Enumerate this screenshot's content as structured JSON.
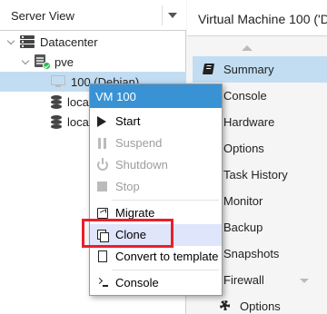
{
  "left_pane": {
    "view_selector": {
      "value": "Server View"
    },
    "tree": {
      "datacenter": {
        "label": "Datacenter",
        "icon": "datacenter-icon"
      },
      "node": {
        "label": "pve",
        "icon": "server-node-icon",
        "status_color": "#21bf4b"
      },
      "vm": {
        "label": "100 (Debian)",
        "icon": "vm-icon"
      },
      "storages": [
        {
          "label": "loca",
          "icon": "storage-icon"
        },
        {
          "label": "loca",
          "icon": "storage-icon"
        }
      ]
    }
  },
  "right_pane": {
    "header_title": "Virtual Machine 100 ('De",
    "nav": [
      {
        "label": "Summary",
        "active": true
      },
      {
        "label": "Console"
      },
      {
        "label": "Hardware"
      },
      {
        "label": "Options"
      },
      {
        "label": "Task History"
      },
      {
        "label": "Monitor"
      },
      {
        "label": "Backup"
      },
      {
        "label": "Snapshots"
      },
      {
        "label": "Firewall"
      },
      {
        "label": "Options",
        "sub": true
      }
    ]
  },
  "context_menu": {
    "title": "VM 100",
    "items": [
      {
        "label": "Start",
        "icon": "play-icon",
        "enabled": true
      },
      {
        "label": "Suspend",
        "icon": "pause-icon",
        "enabled": false
      },
      {
        "label": "Shutdown",
        "icon": "power-icon",
        "enabled": false
      },
      {
        "label": "Stop",
        "icon": "stop-icon",
        "enabled": false
      },
      {
        "label": "Migrate",
        "icon": "send-icon",
        "enabled": true
      },
      {
        "label": "Clone",
        "icon": "clone-icon",
        "enabled": true,
        "highlighted": true
      },
      {
        "label": "Convert to template",
        "icon": "file-icon",
        "enabled": true
      },
      {
        "label": "Console",
        "icon": "terminal-icon",
        "enabled": true
      }
    ]
  },
  "colors": {
    "selection": "#c2ddf2",
    "menu_header": "#3892d4",
    "highlight_box": "#e8202a"
  }
}
